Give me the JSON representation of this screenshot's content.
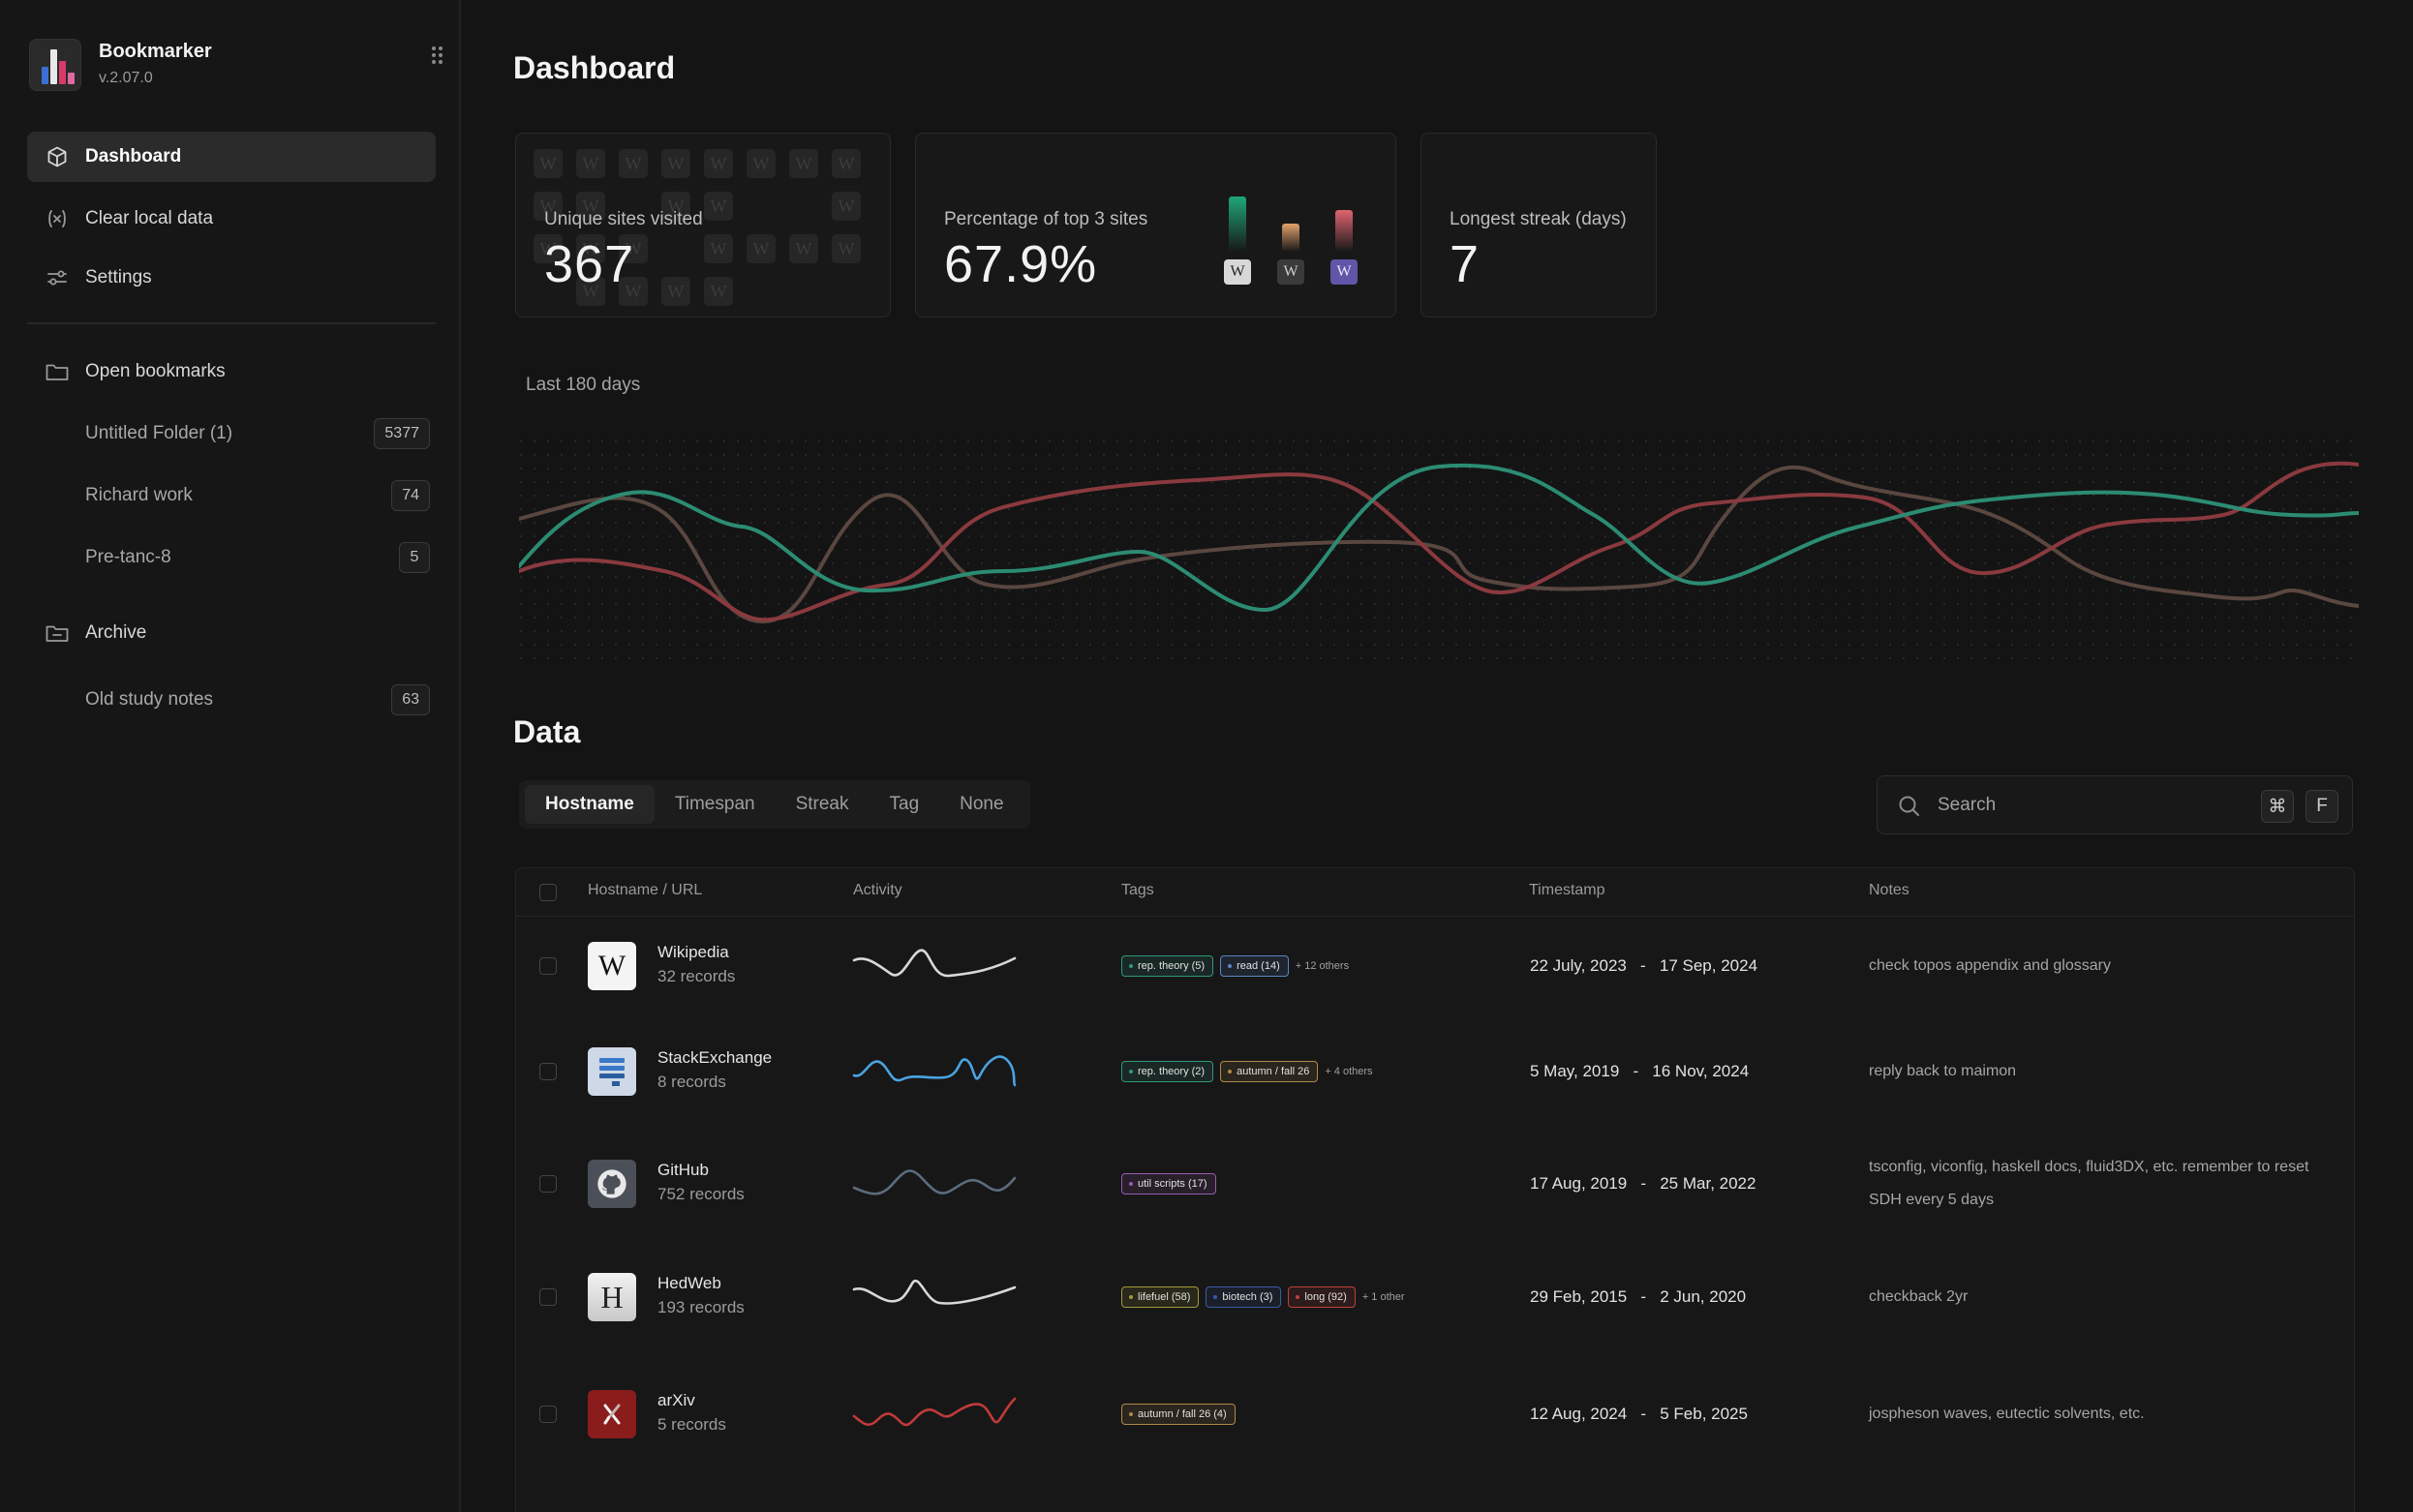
{
  "app": {
    "name": "Bookmarker",
    "version": "v.2.07.0"
  },
  "sidebar": {
    "nav": [
      {
        "label": "Dashboard",
        "icon": "cube-icon",
        "active": true
      },
      {
        "label": "Clear local data",
        "icon": "variable-icon"
      },
      {
        "label": "Settings",
        "icon": "sliders-icon"
      }
    ],
    "open_bookmarks": {
      "label": "Open bookmarks",
      "folders": [
        {
          "label": "Untitled Folder (1)",
          "count": "5377"
        },
        {
          "label": "Richard work",
          "count": "74"
        },
        {
          "label": "Pre-tanc-8",
          "count": "5"
        }
      ]
    },
    "archive": {
      "label": "Archive",
      "folders": [
        {
          "label": "Old study notes",
          "count": "63"
        }
      ]
    }
  },
  "page": {
    "title": "Dashboard"
  },
  "stats": {
    "unique_sites": {
      "label": "Unique sites visited",
      "value": "367"
    },
    "top3": {
      "label": "Percentage of top 3 sites",
      "value": "67.9%",
      "bars": [
        {
          "value": 0.82,
          "color": "#1fa67a",
          "icon_bg": "#d8d8d8",
          "icon_fg": "#222"
        },
        {
          "value": 0.42,
          "color": "#e3a26b",
          "icon_bg": "#3a3a3a",
          "icon_fg": "#cfcfcf"
        },
        {
          "value": 0.62,
          "color": "#e06470",
          "icon_bg": "#5f56a8",
          "icon_fg": "#e8e8ff"
        }
      ]
    },
    "streak": {
      "label": "Longest streak (days)",
      "value": "7"
    }
  },
  "activity": {
    "range_label": "Last 180 days",
    "colors": {
      "green": "#2c8c73",
      "red": "#8a3a3f",
      "brown": "#5a4740"
    }
  },
  "data_section": {
    "title": "Data",
    "tabs": [
      "Hostname",
      "Timespan",
      "Streak",
      "Tag",
      "None"
    ],
    "active_tab": 0,
    "search": {
      "placeholder": "Search",
      "kbd1": "⌘",
      "kbd2": "F"
    },
    "columns": [
      "Hostname / URL",
      "Activity",
      "Tags",
      "Timestamp",
      "Notes"
    ],
    "rows": [
      {
        "host": "Wikipedia",
        "records": "32 records",
        "favicon": "wikipedia-favicon",
        "spark_color": "#d8d8d8",
        "tags": [
          {
            "label": "rep. theory (5)",
            "color": "#2f9a7c"
          },
          {
            "label": "read (14)",
            "color": "#5a86c8"
          }
        ],
        "more": "+ 12 others",
        "ts_start": "22 July, 2023",
        "ts_end": "17 Sep, 2024",
        "notes": "check topos appendix and glossary"
      },
      {
        "host": "StackExchange",
        "records": "8 records",
        "favicon": "stackexchange-favicon",
        "spark_color": "#4aa3e0",
        "tags": [
          {
            "label": "rep. theory (2)",
            "color": "#2f9a7c"
          },
          {
            "label": "autumn / fall 26",
            "color": "#b08a4a"
          }
        ],
        "more": "+ 4 others",
        "ts_start": "5 May, 2019",
        "ts_end": "16 Nov, 2024",
        "notes": "reply back to maimon"
      },
      {
        "host": "GitHub",
        "records": "752 records",
        "favicon": "github-favicon",
        "spark_color": "#5c6c7e",
        "tags": [
          {
            "label": "util scripts (17)",
            "color": "#9a5ab0"
          }
        ],
        "more": "",
        "ts_start": "17 Aug, 2019",
        "ts_end": "25 Mar, 2022",
        "notes": "tsconfig, viconfig, haskell docs, fluid3DX, etc. remember to reset SDH every 5 days"
      },
      {
        "host": "HedWeb",
        "records": "193 records",
        "favicon": "hedweb-favicon",
        "spark_color": "#d8d8d8",
        "tags": [
          {
            "label": "lifefuel (58)",
            "color": "#a09a3a"
          },
          {
            "label": "biotech (3)",
            "color": "#3a5aa8"
          },
          {
            "label": "long (92)",
            "color": "#c0403a"
          }
        ],
        "more": "+ 1 other",
        "ts_start": "29 Feb, 2015",
        "ts_end": "2 Jun, 2020",
        "notes": "checkback 2yr"
      },
      {
        "host": "arXiv",
        "records": "5 records",
        "favicon": "arxiv-favicon",
        "spark_color": "#c03a3a",
        "tags": [
          {
            "label": "autumn / fall 26 (4)",
            "color": "#b08a4a"
          }
        ],
        "more": "",
        "ts_start": "12 Aug, 2024",
        "ts_end": "5 Feb, 2025",
        "notes": "jospheson waves, eutectic solvents, etc."
      }
    ]
  }
}
